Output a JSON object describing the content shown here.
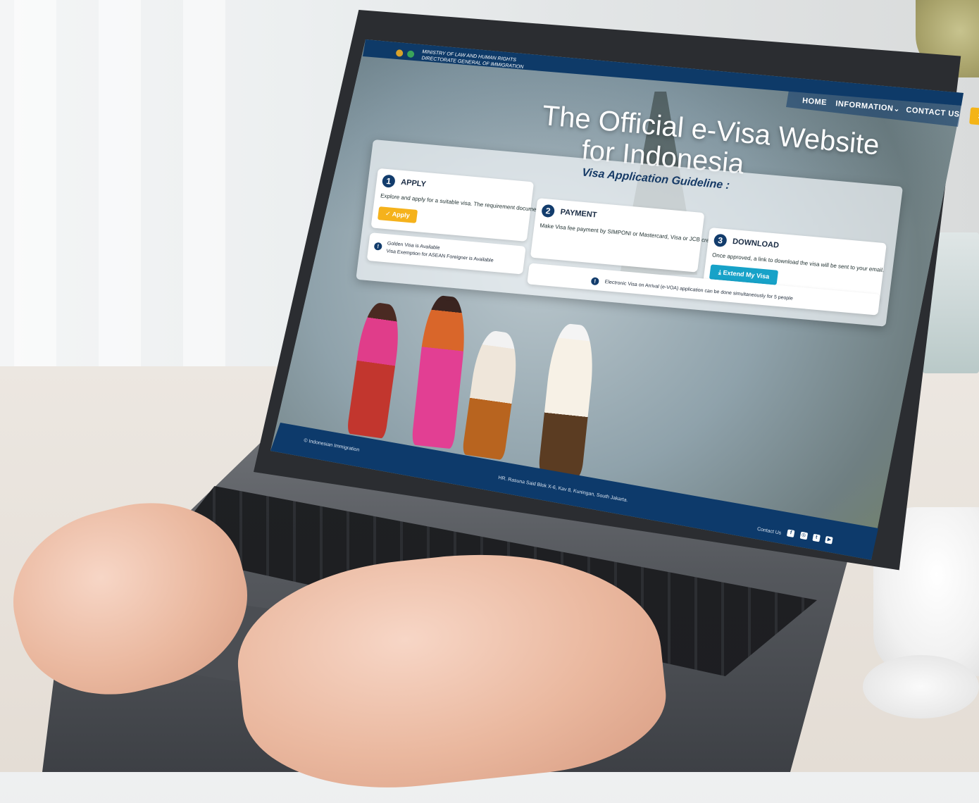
{
  "header": {
    "org_line1": "MINISTRY OF LAW AND HUMAN RIGHTS",
    "org_line2": "DIRECTORATE GENERAL OF IMMIGRATION"
  },
  "nav": {
    "home": "HOME",
    "information": "INFORMATION",
    "information_chevron": "⌄",
    "contact": "CONTACT US",
    "signin": "Sign In"
  },
  "hero": {
    "title_line1": "The Official e-Visa Website",
    "title_line2": "for Indonesia"
  },
  "guideline": {
    "title": "Visa Application Guideline :",
    "steps": [
      {
        "number": "1",
        "title": "APPLY",
        "text": "Explore and apply for a suitable visa. The requirement documents should be prepared.",
        "button": "Apply",
        "button_icon": "check-icon"
      },
      {
        "number": "2",
        "title": "PAYMENT",
        "text": "Make Visa fee payment by SIMPONI or Mastercard, Visa or JCB credit/debit card."
      },
      {
        "number": "3",
        "title": "DOWNLOAD",
        "text": "Once approved, a link to download the visa will be sent to your email.",
        "button": "Extend My Visa",
        "button_icon": "download-icon"
      }
    ],
    "notice_left_line1": "Golden Visa is Available",
    "notice_left_line2": "Visa Exemption for ASEAN Foreigner is Available",
    "notice_right": "Electronic Visa on Arrival (e-VOA) application can be done simultaneously for 5 people"
  },
  "footer": {
    "copyright": "© Indonesian Immigration",
    "address": "HR. Rasuna Said Blok X-6, Kav 8, Kuningan, South Jakarta.",
    "contact_label": "Contact Us",
    "social": [
      "facebook-icon",
      "instagram-icon",
      "twitter-icon",
      "youtube-icon"
    ]
  },
  "colors": {
    "navy": "#0e3a68",
    "accent_yellow": "#f4b417",
    "accent_cyan": "#17a2c8"
  }
}
